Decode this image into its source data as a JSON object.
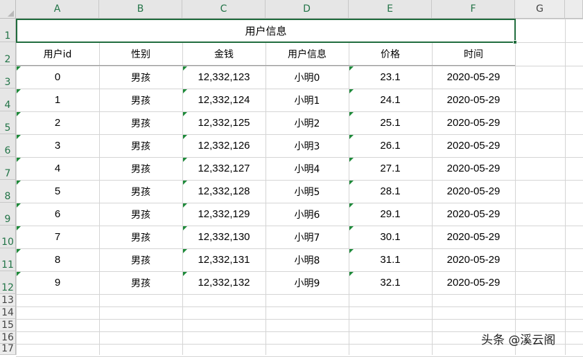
{
  "columns": [
    "A",
    "B",
    "C",
    "D",
    "E",
    "F",
    "G"
  ],
  "rows": [
    "1",
    "2",
    "3",
    "4",
    "5",
    "6",
    "7",
    "8",
    "9",
    "10",
    "11",
    "12",
    "13",
    "14",
    "15",
    "16",
    "17"
  ],
  "title": "用户信息",
  "headers": [
    "用户id",
    "性别",
    "金钱",
    "用户信息",
    "价格",
    "时间"
  ],
  "table_rows": [
    [
      "0",
      "男孩",
      "12,332,123",
      "小明0",
      "23.1",
      "2020-05-29"
    ],
    [
      "1",
      "男孩",
      "12,332,124",
      "小明1",
      "24.1",
      "2020-05-29"
    ],
    [
      "2",
      "男孩",
      "12,332,125",
      "小明2",
      "25.1",
      "2020-05-29"
    ],
    [
      "3",
      "男孩",
      "12,332,126",
      "小明3",
      "26.1",
      "2020-05-29"
    ],
    [
      "4",
      "男孩",
      "12,332,127",
      "小明4",
      "27.1",
      "2020-05-29"
    ],
    [
      "5",
      "男孩",
      "12,332,128",
      "小明5",
      "28.1",
      "2020-05-29"
    ],
    [
      "6",
      "男孩",
      "12,332,129",
      "小明6",
      "29.1",
      "2020-05-29"
    ],
    [
      "7",
      "男孩",
      "12,332,130",
      "小明7",
      "30.1",
      "2020-05-29"
    ],
    [
      "8",
      "男孩",
      "12,332,131",
      "小明8",
      "31.1",
      "2020-05-29"
    ],
    [
      "9",
      "男孩",
      "12,332,132",
      "小明9",
      "32.1",
      "2020-05-29"
    ]
  ],
  "watermark": "头条 @溪云阁",
  "colors": {
    "accent": "#217346",
    "selection_border": "#1f6b3c",
    "error_flag": "#1e8a3a"
  }
}
